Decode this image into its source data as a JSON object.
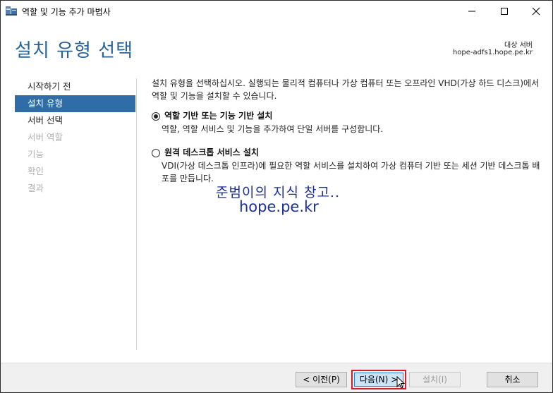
{
  "window": {
    "title": "역할 및 기능 추가 마법사"
  },
  "header": {
    "page_title": "설치 유형 선택",
    "target_label": "대상 서버",
    "target_value": "hope-adfs1.hope.pe.kr"
  },
  "sidebar": {
    "items": [
      {
        "label": "시작하기 전",
        "state": "normal"
      },
      {
        "label": "설치 유형",
        "state": "active"
      },
      {
        "label": "서버 선택",
        "state": "normal"
      },
      {
        "label": "서버 역할",
        "state": "disabled"
      },
      {
        "label": "기능",
        "state": "disabled"
      },
      {
        "label": "확인",
        "state": "disabled"
      },
      {
        "label": "결과",
        "state": "disabled"
      }
    ]
  },
  "content": {
    "intro": "설치 유형을 선택하십시오. 실행되는 물리적 컴퓨터나 가상 컴퓨터 또는 오프라인 VHD(가상 하드 디스크)에서 역할 및 기능을 설치할 수 있습니다.",
    "options": [
      {
        "title": "역할 기반 또는 기능 기반 설치",
        "desc": "역할, 역할 서비스 및 기능을 추가하여 단일 서버를 구성합니다.",
        "selected": true
      },
      {
        "title": "원격 데스크톱 서비스 설치",
        "desc": "VDI(가상 데스크톱 인프라)에 필요한 역할 서비스를 설치하여 가상 컴퓨터 기반 또는 세션 기반 데스크톱 배포를 만듭니다.",
        "selected": false
      }
    ]
  },
  "watermark": {
    "line1": "준범이의 지식 창고..",
    "line2": "hope.pe.kr"
  },
  "footer": {
    "prev": "< 이전(P)",
    "next": "다음(N) >",
    "install": "설치(I)",
    "cancel": "취소"
  },
  "colors": {
    "accent": "#2f6ca8",
    "title": "#2a6496",
    "highlight": "#d21e2b"
  }
}
